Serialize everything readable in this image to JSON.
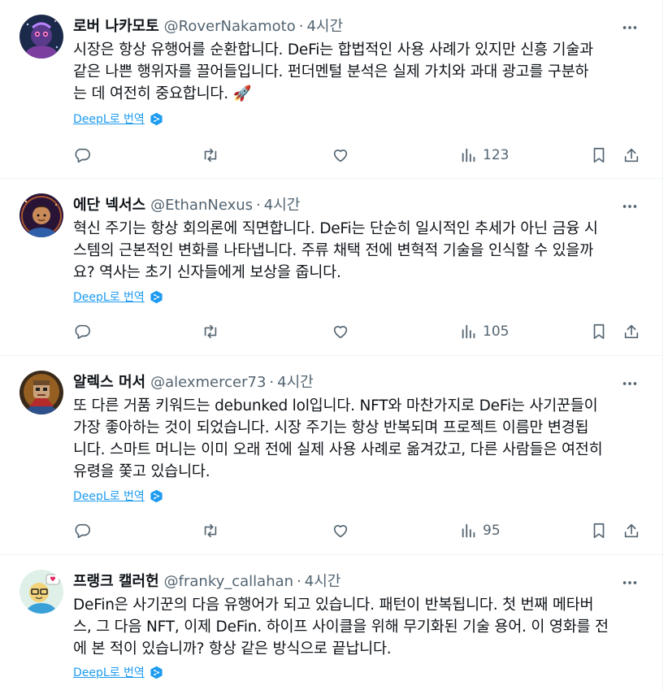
{
  "tweets": [
    {
      "name": "로버 나카모토",
      "handle": "@RoverNakamoto",
      "dot": "·",
      "time": "4시간",
      "lines": [
        "시장은 항상 유행어를 순환합니다. DeFi는 합법적인 사용 사례가 있지만 신흥 기술과",
        "같은 나쁜 행위자를 끌어들입니다. 펀더멘털 분석은 실제 가치와 과대 광고를 구분하",
        "는 데 여전히 중요합니다. 🚀"
      ],
      "translate_label": "DeepL로 번역",
      "views": "123"
    },
    {
      "name": "에단 넥서스",
      "handle": "@EthanNexus",
      "dot": "·",
      "time": "4시간",
      "lines": [
        "혁신 주기는 항상 회의론에 직면합니다. DeFi는 단순히 일시적인 추세가 아닌 금융 시",
        "스템의 근본적인 변화를 나타냅니다. 주류 채택 전에 변혁적 기술을 인식할 수 있을까",
        "요? 역사는 초기 신자들에게 보상을 줍니다."
      ],
      "translate_label": "DeepL로 번역",
      "views": "105"
    },
    {
      "name": "알렉스 머서",
      "handle": "@alexmercer73",
      "dot": "·",
      "time": "4시간",
      "lines": [
        "또 다른 거품 키워드는 debunked lol입니다. NFT와 마찬가지로 DeFi는 사기꾼들이",
        "가장 좋아하는 것이 되었습니다. 시장 주기는 항상 반복되며 프로젝트 이름만 변경됩",
        "니다. 스마트 머니는 이미 오래 전에 실제 사용 사례로 옮겨갔고, 다른 사람들은 여전히",
        "유령을 쫓고 있습니다."
      ],
      "translate_label": "DeepL로 번역",
      "views": "95"
    },
    {
      "name": "프랭크 캘러헌",
      "handle": "@franky_callahan",
      "dot": "·",
      "time": "4시간",
      "lines": [
        "DeFin은 사기꾼의 다음 유행어가 되고 있습니다. 패턴이 반복됩니다. 첫 번째 메타버",
        "스, 그 다음 NFT, 이제 DeFin. 하이프 사이클을 위해 무기화된 기술 용어. 이 영화를 전",
        "에 본 적이 있습니까? 항상 같은 방식으로 끝납니다."
      ],
      "translate_label": "DeepL로 번역",
      "views": ""
    }
  ],
  "icons": {
    "reply": "reply-icon",
    "retweet": "retweet-icon",
    "like": "like-icon",
    "views": "views-icon",
    "bookmark": "bookmark-icon",
    "share": "share-icon",
    "more": "more-icon",
    "deepl": "deepl-icon"
  },
  "colors": {
    "text": "#0f1419",
    "secondary": "#536471",
    "link": "#1d9bf0",
    "border": "#eff3f4"
  }
}
